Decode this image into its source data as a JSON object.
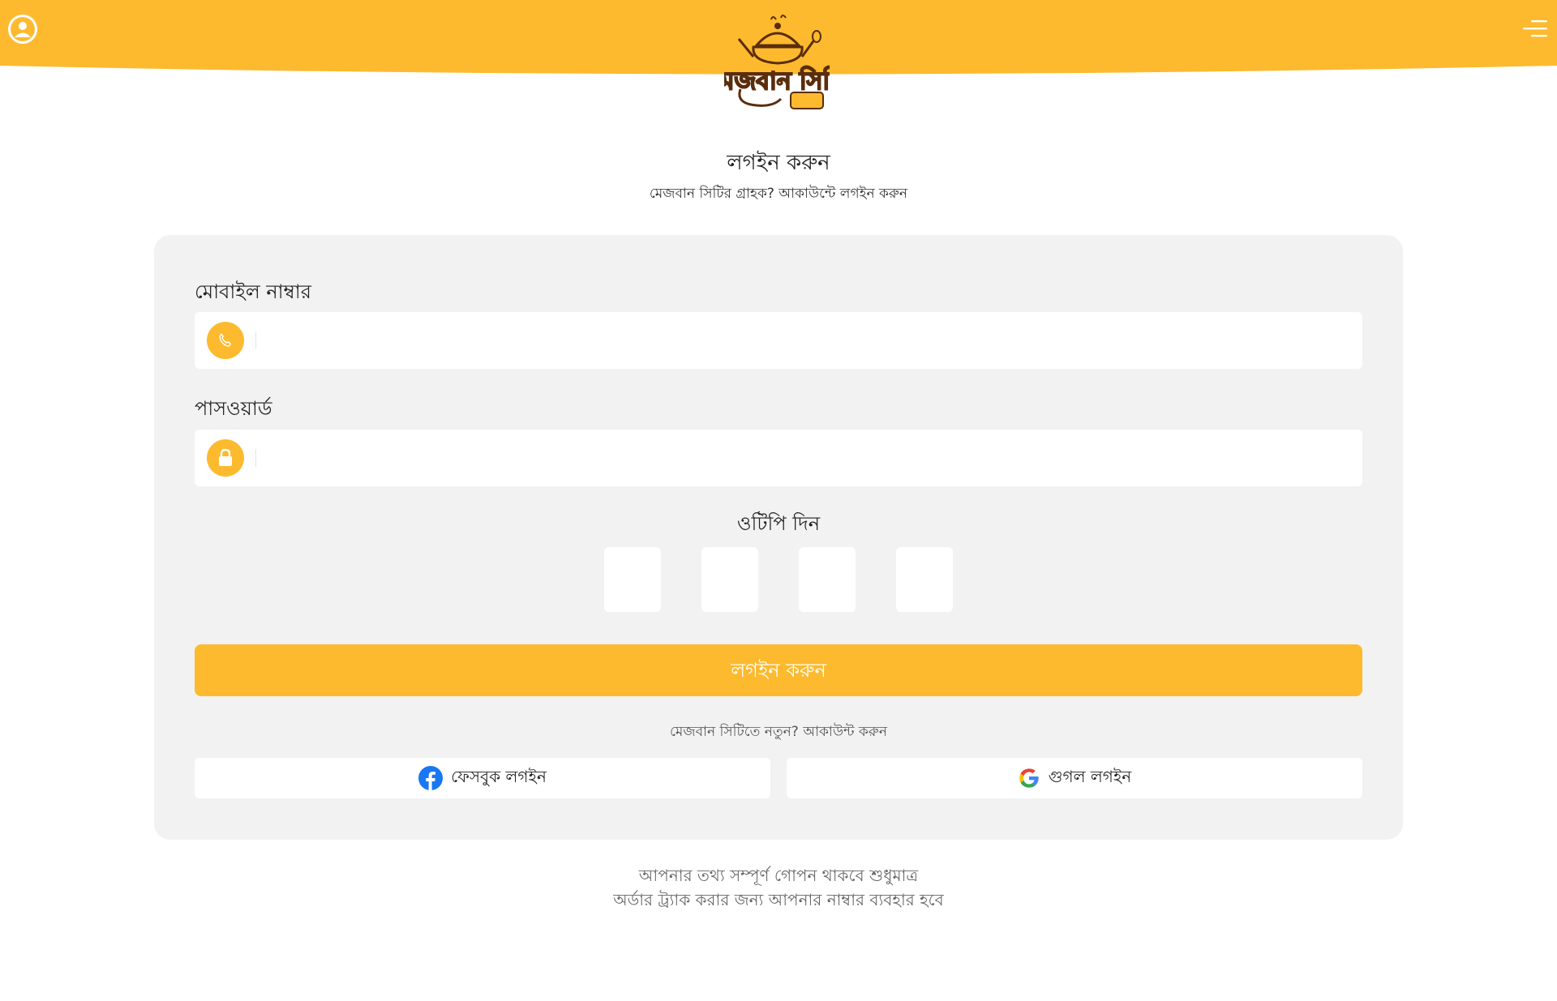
{
  "header": {
    "brand_name": "মেজবান সিটি",
    "avatar_icon": "user-avatar-icon",
    "menu_icon": "hamburger-menu-icon",
    "brand_color": "#fdba2e"
  },
  "login": {
    "title": "লগইন করুন",
    "subtitle": "মেজবান সিটির গ্রাহক? আকাউন্টে লগইন করুন",
    "mobile_label": "মোবাইল নাম্বার",
    "mobile_value": "",
    "mobile_icon": "phone-icon",
    "password_label": "পাসওয়ার্ড",
    "password_value": "",
    "password_icon": "lock-icon",
    "otp_label": "ওটিপি দিন",
    "otp_digits": [
      "",
      "",
      "",
      ""
    ],
    "submit_label": "লগইন করুন",
    "register_text": "মেজবান সিটিতে নতুন? আকাউন্ট করুন",
    "facebook_label": "ফেসবুক লগইন",
    "google_label": "গুগল লগইন"
  },
  "footer": {
    "line1": "আপনার তথ্য সম্পূর্ণ গোপন থাকবে শুধুমাত্র",
    "line2": "অর্ডার ট্র্যাক করার জন্য আপনার নাম্বার ব্যবহার হবে"
  }
}
